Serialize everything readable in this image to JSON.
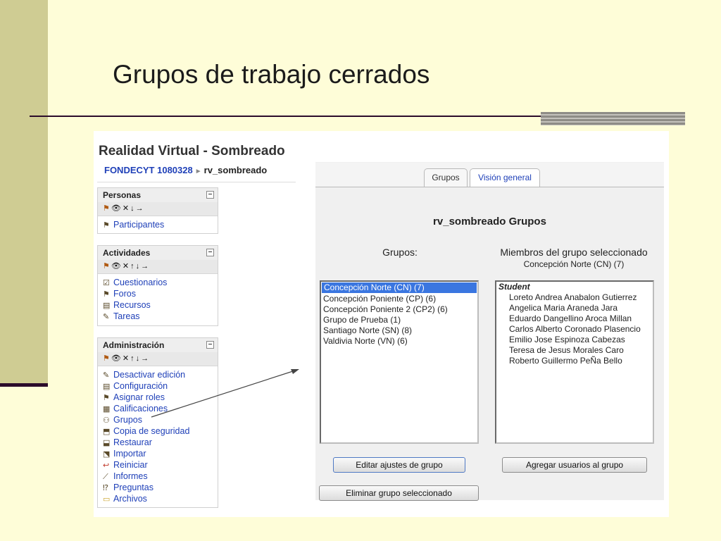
{
  "slide": {
    "title": "Grupos de trabajo cerrados"
  },
  "course": {
    "title": "Realidad Virtual - Sombreado"
  },
  "breadcrumb": {
    "root": "FONDECYT 1080328",
    "separator": "►",
    "current": "rv_sombreado"
  },
  "blocks": {
    "personas": {
      "title": "Personas",
      "collapse": "–",
      "items": [
        {
          "label": "Participantes",
          "icon": "people-icon"
        }
      ]
    },
    "actividades": {
      "title": "Actividades",
      "collapse": "–",
      "items": [
        {
          "label": "Cuestionarios",
          "icon": "quiz-icon"
        },
        {
          "label": "Foros",
          "icon": "forum-icon"
        },
        {
          "label": "Recursos",
          "icon": "resource-icon"
        },
        {
          "label": "Tareas",
          "icon": "assignment-icon"
        }
      ]
    },
    "administracion": {
      "title": "Administración",
      "collapse": "–",
      "items": [
        {
          "label": "Desactivar edición",
          "icon": "edit-icon"
        },
        {
          "label": "Configuración",
          "icon": "settings-icon"
        },
        {
          "label": "Asignar roles",
          "icon": "roles-icon"
        },
        {
          "label": "Calificaciones",
          "icon": "grades-icon"
        },
        {
          "label": "Grupos",
          "icon": "groups-icon"
        },
        {
          "label": "Copia de seguridad",
          "icon": "backup-icon"
        },
        {
          "label": "Restaurar",
          "icon": "restore-icon"
        },
        {
          "label": "Importar",
          "icon": "import-icon"
        },
        {
          "label": "Reiniciar",
          "icon": "reset-icon"
        },
        {
          "label": "Informes",
          "icon": "reports-icon"
        },
        {
          "label": "Preguntas",
          "icon": "questions-icon"
        },
        {
          "label": "Archivos",
          "icon": "folder-icon"
        }
      ]
    }
  },
  "tabs": {
    "groups": "Grupos",
    "overview": "Visión general"
  },
  "main": {
    "heading": "rv_sombreado Grupos",
    "groups_label": "Grupos:",
    "members_label": "Miembros del grupo seleccionado",
    "selected_group": "Concepción Norte (CN) (7)",
    "groups": [
      "Concepción Norte (CN) (7)",
      "Concepción Poniente (CP) (6)",
      "Concepción Poniente 2 (CP2) (6)",
      "Grupo de Prueba (1)",
      "Santiago Norte (SN) (8)",
      "Valdivia Norte (VN) (6)"
    ],
    "role": "Student",
    "members": [
      "Loreto Andrea Anabalon Gutierrez",
      "Angelica Maria Araneda Jara",
      "Eduardo Dangellino Aroca Millan",
      "Carlos Alberto Coronado Plasencio",
      "Emilio Jose Espinoza Cabezas",
      "Teresa de Jesus Morales Caro",
      "Roberto Guillermo PeÑa Bello"
    ],
    "buttons": {
      "edit": "Editar ajustes de grupo",
      "add_users": "Agregar usuarios al grupo",
      "delete": "Eliminar grupo seleccionado"
    }
  },
  "colors": {
    "link": "#1f40b8",
    "selection": "#3a76e0",
    "slide_bg": "#fefdd8",
    "slide_bar": "#cfcc93"
  }
}
